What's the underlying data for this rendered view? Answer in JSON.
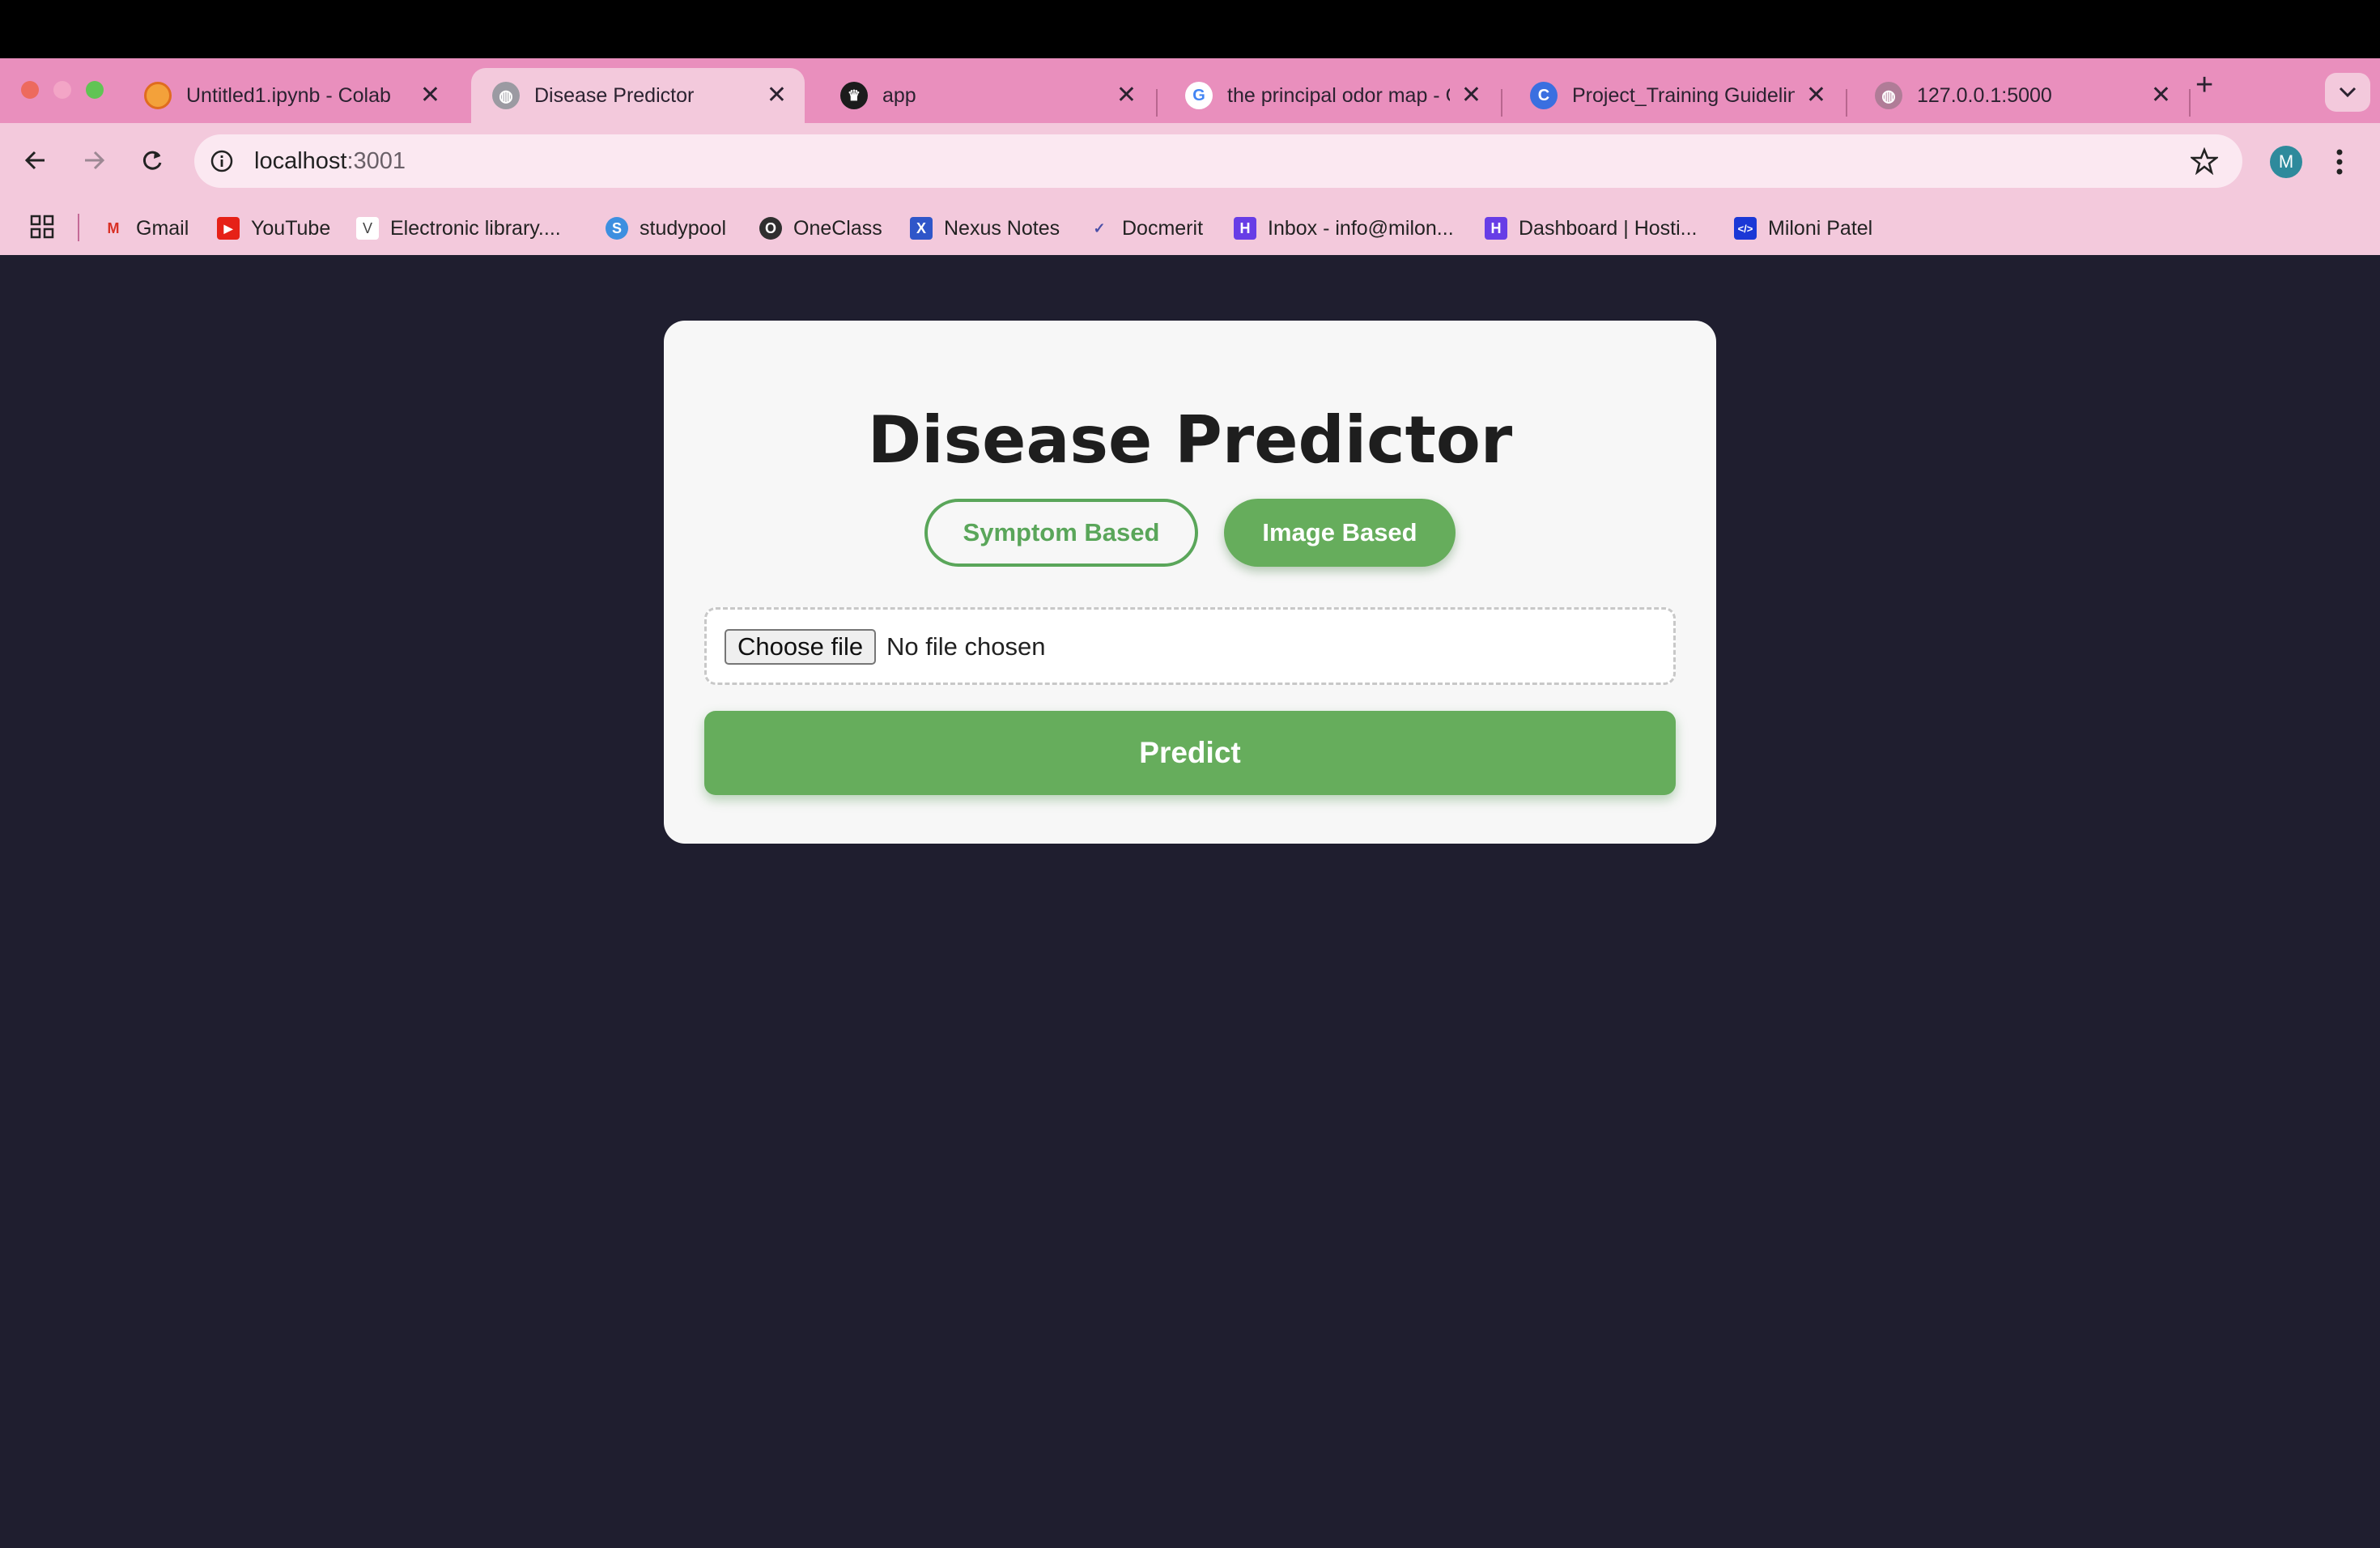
{
  "browser": {
    "tabs": [
      {
        "title": "Untitled1.ipynb - Colab",
        "icon": "colab-icon"
      },
      {
        "title": "Disease Predictor",
        "icon": "globe-icon"
      },
      {
        "title": "app",
        "icon": "streamlit-icon"
      },
      {
        "title": "the principal odor map - G",
        "icon": "google-icon"
      },
      {
        "title": "Project_Training Guidelin",
        "icon": "chatgpt-c-icon"
      },
      {
        "title": "127.0.0.1:5000",
        "icon": "globe-icon"
      }
    ],
    "active_tab": 1,
    "address": {
      "host": "localhost",
      "port": ":3001"
    },
    "avatar_letter": "M",
    "bookmarks": [
      {
        "label": "Gmail",
        "icon": "gmail-icon"
      },
      {
        "label": "YouTube",
        "icon": "youtube-icon"
      },
      {
        "label": "Electronic library....",
        "icon": "v-icon"
      },
      {
        "label": "studypool",
        "icon": "studypool-icon"
      },
      {
        "label": "OneClass",
        "icon": "oneclass-icon"
      },
      {
        "label": "Nexus Notes",
        "icon": "nexus-icon"
      },
      {
        "label": "Docmerit",
        "icon": "docmerit-icon"
      },
      {
        "label": "Inbox - info@milon...",
        "icon": "hostinger-icon"
      },
      {
        "label": "Dashboard | Hosti...",
        "icon": "hostinger-icon"
      },
      {
        "label": "Miloni Patel",
        "icon": "code-icon"
      }
    ]
  },
  "app": {
    "title": "Disease Predictor",
    "modes": {
      "symptom": "Symptom Based",
      "image": "Image Based"
    },
    "file_input": {
      "button": "Choose file",
      "status": "No file chosen"
    },
    "predict_label": "Predict"
  },
  "colors": {
    "page_bg": "#1f1e2f",
    "accent_green": "#66ad5c",
    "tabstrip": "#e98fbd",
    "toolbar": "#f3c9dc"
  }
}
